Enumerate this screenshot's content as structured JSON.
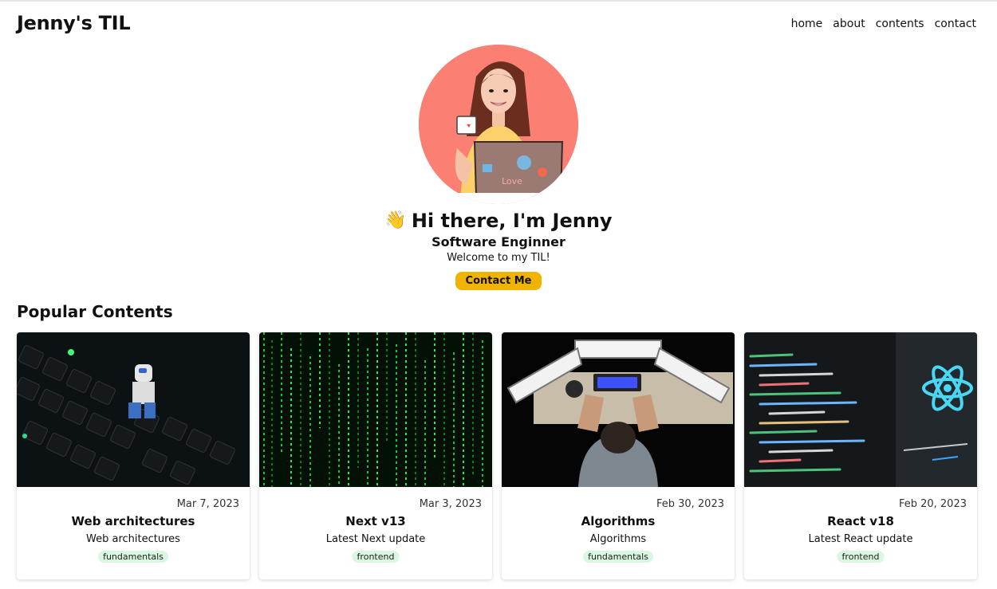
{
  "header": {
    "brand": "Jenny's TIL",
    "nav": [
      "home",
      "about",
      "contents",
      "contact"
    ]
  },
  "hero": {
    "wave_icon": "waving-hand-icon",
    "greeting": "Hi there, I'm Jenny",
    "role": "Software Enginner",
    "welcome": "Welcome to my TIL!",
    "contact_label": "Contact Me"
  },
  "colors": {
    "accent": "#f0b400",
    "avatar_bg": "#fb7f73",
    "tag_bg": "#d9f7e1"
  },
  "popular": {
    "title": "Popular Contents",
    "cards": [
      {
        "date": "Mar 7, 2023",
        "title": "Web architectures",
        "description": "Web architectures",
        "tag": "fundamentals"
      },
      {
        "date": "Mar 3, 2023",
        "title": "Next v13",
        "description": "Latest Next update",
        "tag": "frontend"
      },
      {
        "date": "Feb 30, 2023",
        "title": "Algorithms",
        "description": "Algorithms",
        "tag": "fundamentals"
      },
      {
        "date": "Feb 20, 2023",
        "title": "React v18",
        "description": "Latest React update",
        "tag": "frontend"
      }
    ]
  }
}
